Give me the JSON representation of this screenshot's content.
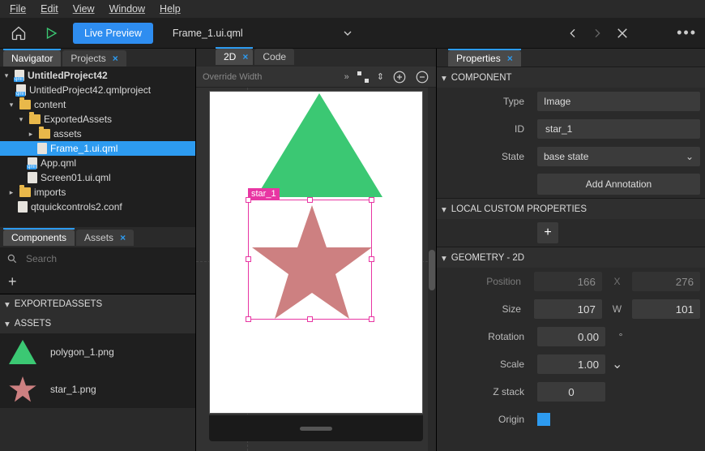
{
  "menubar": [
    "File",
    "Edit",
    "View",
    "Window",
    "Help"
  ],
  "toolbar": {
    "live_preview": "Live Preview",
    "open_file": "Frame_1.ui.qml"
  },
  "left": {
    "tab_navigator": "Navigator",
    "tab_projects": "Projects",
    "tree": {
      "root": "UntitledProject42",
      "qmlproject": "UntitledProject42.qmlproject",
      "content": "content",
      "exported": "ExportedAssets",
      "assets": "assets",
      "frame": "Frame_1.ui.qml",
      "app": "App.qml",
      "screen": "Screen01.ui.qml",
      "imports": "imports",
      "conf": "qtquickcontrols2.conf"
    },
    "tab_components": "Components",
    "tab_assets": "Assets",
    "search_placeholder": "Search",
    "section_exported": "EXPORTEDASSETS",
    "section_assets": "ASSETS",
    "asset1": "polygon_1.png",
    "asset2": "star_1.png"
  },
  "center": {
    "tab_2d": "2D",
    "tab_code": "Code",
    "override": "Override Width",
    "selection_label": "star_1"
  },
  "right": {
    "tab_properties": "Properties",
    "sect_component": "COMPONENT",
    "type_label": "Type",
    "type_value": "Image",
    "id_label": "ID",
    "id_value": "star_1",
    "state_label": "State",
    "state_value": "base state",
    "add_annotation": "Add Annotation",
    "sect_local": "LOCAL CUSTOM PROPERTIES",
    "sect_geom": "GEOMETRY - 2D",
    "pos_label": "Position",
    "pos_x": "166",
    "pos_y": "276",
    "size_label": "Size",
    "size_w": "107",
    "size_h": "101",
    "rot_label": "Rotation",
    "rot_value": "0.00",
    "rot_unit": "°",
    "scale_label": "Scale",
    "scale_value": "1.00",
    "z_label": "Z stack",
    "z_value": "0",
    "origin_label": "Origin",
    "X": "X",
    "W": "W"
  }
}
